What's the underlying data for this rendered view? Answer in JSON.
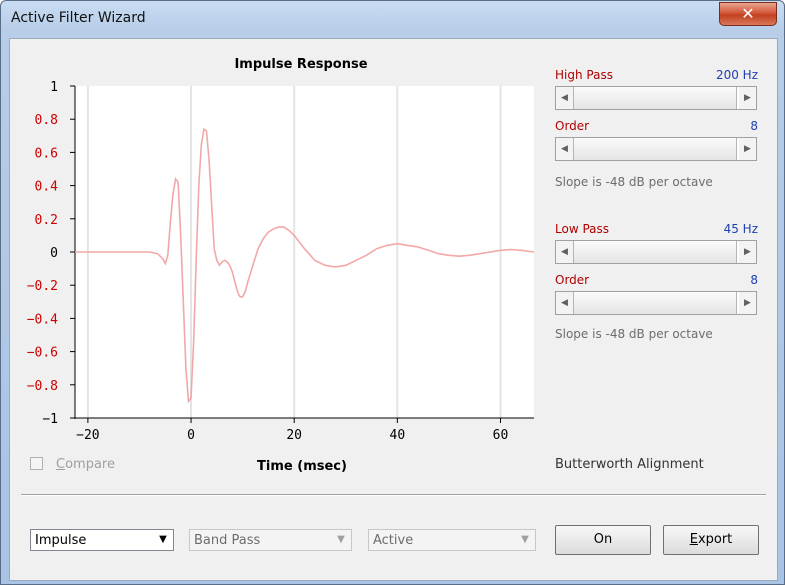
{
  "window": {
    "title": "Active Filter Wizard",
    "close_icon": "close-icon"
  },
  "chart_data": {
    "type": "line",
    "title": "Impulse Response",
    "xlabel": "Time (msec)",
    "ylabel": "",
    "xlim": [
      -22.5,
      66.5
    ],
    "ylim": [
      -1,
      1
    ],
    "x_ticks": [
      -20,
      0,
      20,
      40,
      60
    ],
    "x_tick_labels": [
      "−20",
      "0",
      "20",
      "40",
      "60"
    ],
    "y_ticks": [
      1,
      0.8,
      0.6,
      0.4,
      0.2,
      0,
      -0.2,
      -0.4,
      -0.6,
      -0.8,
      -1
    ],
    "y_tick_labels": [
      "1",
      "0.8",
      "0.6",
      "0.4",
      "0.2",
      "0",
      "−0.2",
      "−0.4",
      "−0.6",
      "−0.8",
      "−1"
    ],
    "y_tick_colors": [
      "#000000",
      "#cc0000",
      "#cc0000",
      "#cc0000",
      "#cc0000",
      "#000000",
      "#cc0000",
      "#cc0000",
      "#cc0000",
      "#cc0000",
      "#000000"
    ],
    "grid": true,
    "line_color": "#f2a8a8",
    "series": [
      {
        "x": [
          -22.5,
          -8,
          -6.5,
          -5.5,
          -5,
          -4.5,
          -4,
          -3.5,
          -3,
          -2.5,
          -2,
          -1.5,
          -1,
          -0.5,
          0,
          0.5,
          1,
          1.5,
          2,
          2.5,
          3,
          3.5,
          4,
          4.5,
          5,
          5.5,
          6,
          6.5,
          7,
          7.5,
          8,
          8.5,
          9,
          9.5,
          10,
          10.5,
          11,
          12,
          13,
          14,
          15,
          16,
          17,
          18,
          19,
          20,
          21,
          22,
          24,
          26,
          28,
          30,
          32,
          34,
          36,
          38,
          40,
          42,
          44,
          46,
          48,
          50,
          52,
          54,
          56,
          58,
          60,
          62,
          64,
          66.5
        ],
        "y": [
          0,
          0,
          -0.01,
          -0.04,
          -0.07,
          -0.02,
          0.18,
          0.35,
          0.44,
          0.42,
          0.1,
          -0.3,
          -0.7,
          -0.9,
          -0.88,
          -0.55,
          -0.05,
          0.4,
          0.65,
          0.74,
          0.73,
          0.55,
          0.28,
          0.02,
          -0.05,
          -0.08,
          -0.06,
          -0.05,
          -0.06,
          -0.08,
          -0.12,
          -0.18,
          -0.24,
          -0.27,
          -0.27,
          -0.24,
          -0.18,
          -0.08,
          0.02,
          0.08,
          0.12,
          0.14,
          0.15,
          0.15,
          0.13,
          0.1,
          0.06,
          0.02,
          -0.05,
          -0.08,
          -0.09,
          -0.08,
          -0.05,
          -0.02,
          0.02,
          0.04,
          0.05,
          0.04,
          0.03,
          0.01,
          -0.01,
          -0.02,
          -0.025,
          -0.02,
          -0.01,
          0,
          0.01,
          0.015,
          0.01,
          0
        ]
      }
    ]
  },
  "compare": {
    "label": "Compare",
    "mnemonic": "C",
    "rest": "ompare",
    "checked": false
  },
  "high_pass": {
    "label": "High Pass",
    "value": "200 Hz",
    "order_label": "Order",
    "order_value": "8",
    "slope_text": "Slope is -48 dB per octave"
  },
  "low_pass": {
    "label": "Low Pass",
    "value": "45 Hz",
    "order_label": "Order",
    "order_value": "8",
    "slope_text": "Slope is -48 dB per octave"
  },
  "alignment": "Butterworth Alignment",
  "bottom": {
    "response_select": "Impulse",
    "filter_type_select": "Band Pass",
    "mode_select": "Active",
    "on_label": "On",
    "export_mnemonic": "E",
    "export_rest": "xport"
  }
}
